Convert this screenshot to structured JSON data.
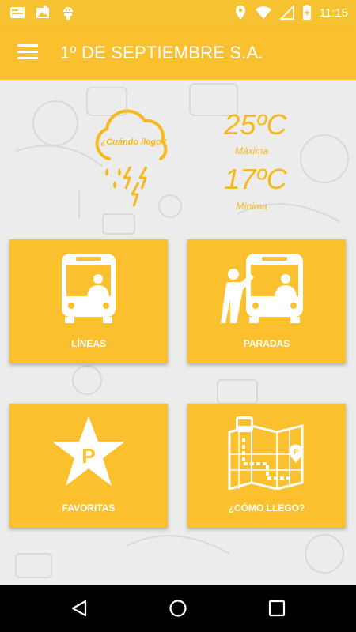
{
  "status_bar": {
    "time": "11:15",
    "left_icons": [
      "notification-card-icon",
      "image-notification-icon",
      "android-icon"
    ],
    "right_icons": [
      "location-icon",
      "wifi-icon",
      "signal-icon",
      "battery-charging-icon"
    ]
  },
  "app_bar": {
    "title": "1º DE SEPTIEMBRE S.A.",
    "menu_icon": "hamburger-menu-icon"
  },
  "weather": {
    "icon": "storm-cloud-icon",
    "cloud_text": "¿Cuándo llego?",
    "max_temp": "25ºC",
    "max_label": "Máxima",
    "min_temp": "17ºC",
    "min_label": "Mínima"
  },
  "tiles": [
    {
      "label": "LÍNEAS",
      "icon": "bus-icon"
    },
    {
      "label": "PARADAS",
      "icon": "bus-stop-icon"
    },
    {
      "label": "FAVORITAS",
      "icon": "star-parking-icon"
    },
    {
      "label": "¿CÓMO LLEGO?",
      "icon": "map-route-icon"
    }
  ],
  "nav_bar": {
    "icons": [
      "back-icon",
      "home-icon",
      "recents-icon"
    ]
  },
  "colors": {
    "primary": "#fbc02d",
    "status_bar": "#f6c231",
    "temperature_text": "#f6b91f",
    "background": "#ececec"
  }
}
